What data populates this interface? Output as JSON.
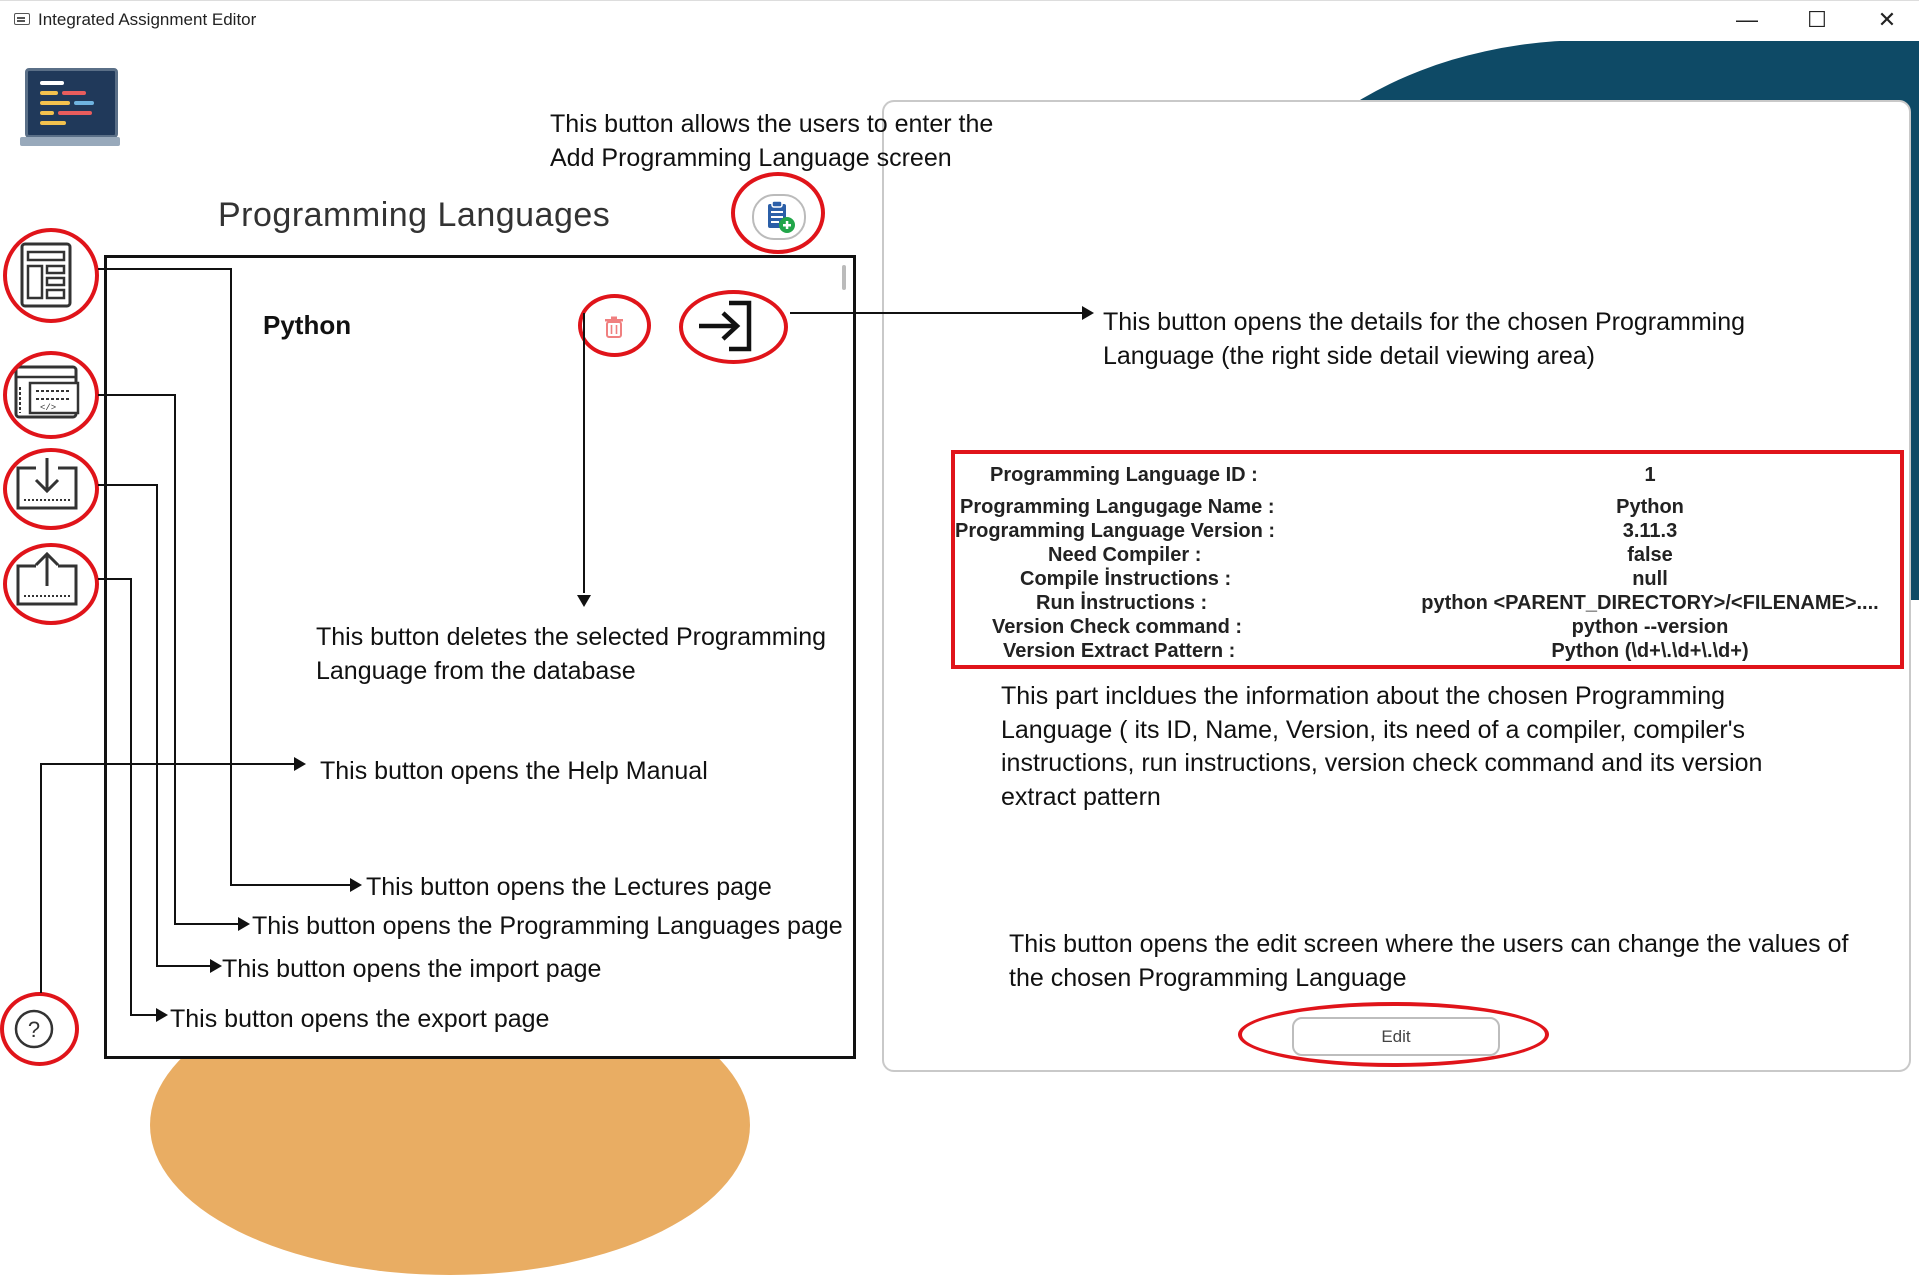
{
  "window": {
    "title": "Integrated Assignment Editor",
    "minimize": "—",
    "maximize": "☐",
    "close": "✕"
  },
  "left_panel": {
    "title": "Programming Languages",
    "items": [
      {
        "name": "Python"
      }
    ]
  },
  "details": {
    "rows": [
      {
        "label": "Programming Language ID :",
        "value": "1"
      },
      {
        "label": "Programming Langugage Name  :",
        "value": "Python"
      },
      {
        "label": "Programming Language Version  :",
        "value": "3.11.3"
      },
      {
        "label": "Need Compiler  :",
        "value": "false"
      },
      {
        "label": "Compile İnstructions :",
        "value": "null"
      },
      {
        "label": "Run İnstructions  :",
        "value": "python <PARENT_DIRECTORY>/<FILENAME>...."
      },
      {
        "label": "Version Check command  :",
        "value": "python --version"
      },
      {
        "label": "Version Extract Pattern  :",
        "value": "Python (\\d+\\.\\d+\\.\\d+)"
      }
    ],
    "edit_label": "Edit"
  },
  "annotations": {
    "add_button_line1": "This button allows the users  to  enter the",
    "add_button_line2": "Add Programming Language  screen",
    "open_details_line1": "This button opens the details for the chosen Programming",
    "open_details_line2": "Language (the right side detail viewing area)",
    "delete_line1": "This button deletes the selected Programming",
    "delete_line2": "Language from the database",
    "help": "This button opens the Help Manual",
    "lectures": "This button opens the Lectures page",
    "languages": "This button opens the Programming Languages page",
    "import": "This button opens the import page",
    "export": "This button opens the export page",
    "info_line1": "This part incldues the information about the chosen Programming",
    "info_line2": "Language ( its ID, Name, Version, its need of a compiler, compiler's",
    "info_line3": "instructions, run instructions, version check command and its version",
    "info_line4": "extract pattern",
    "edit_line1": "This button opens the edit screen where the users can change the values of",
    "edit_line2": "the chosen Programming Language"
  },
  "icons": {
    "app": "keyboard-icon",
    "logo": "laptop-code-icon",
    "nav": [
      "lectures-icon",
      "code-window-icon",
      "import-icon",
      "export-icon",
      "help-icon"
    ],
    "add": "clipboard-add-icon",
    "delete": "trash-icon",
    "open": "enter-arrow-icon"
  },
  "colors": {
    "accent_red": "#e0141a",
    "dark_blue": "#0e4a66",
    "orange": "#e9ad63",
    "add_icon_blue": "#2b5fa8",
    "add_icon_green": "#22a64a"
  }
}
